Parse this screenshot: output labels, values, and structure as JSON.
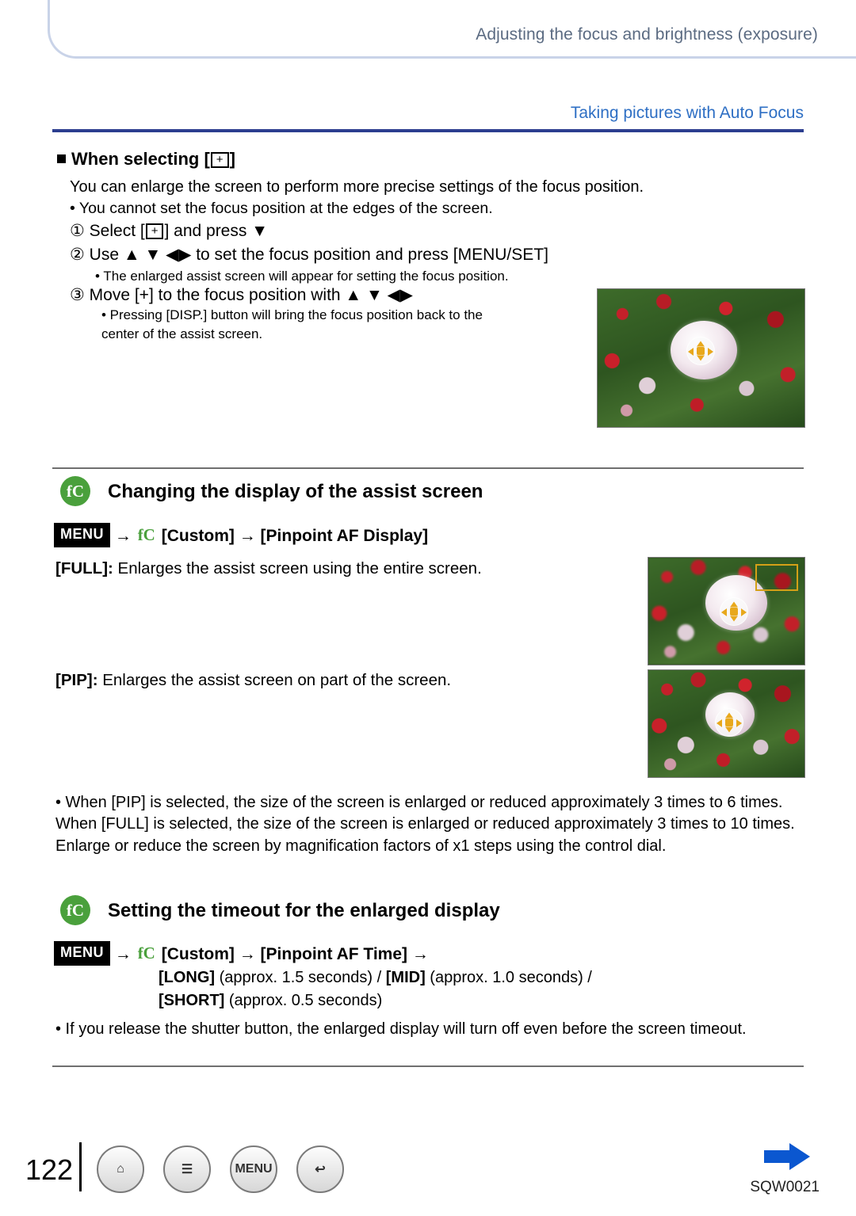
{
  "header": {
    "title": "Adjusting the focus and brightness (exposure)",
    "section": "Taking pictures with Auto Focus"
  },
  "when_selecting": {
    "heading": "When selecting [",
    "heading_icon": "+",
    "heading_end": "]",
    "line1": "You can enlarge the screen to perform more precise settings of the focus position.",
    "line2": "• You cannot set the focus position at the edges of the screen.",
    "step1_pre": "① Select [",
    "step1_icon": "+",
    "step1_post": "] and press ▼",
    "step2": "② Use ▲ ▼ ◀▶ to set the focus position and press [MENU/SET]",
    "step2_note": "• The enlarged assist screen will appear for setting the focus position.",
    "step3": "③ Move [+] to the focus position with ▲ ▼ ◀▶",
    "step3_note_line1": "• Pressing [DISP.] button will bring the focus position back to the",
    "step3_note_line2": "center of the assist screen."
  },
  "section_display": {
    "badge": "fC",
    "title": "Changing the display of the assist screen",
    "menu_chip": "MENU",
    "arrow": "→",
    "wrench": "fC",
    "path_custom": "[Custom]",
    "path_item": "[Pinpoint AF Display]",
    "full_label": "[FULL]:",
    "full_text": " Enlarges the assist screen using the entire screen.",
    "pip_label": "[PIP]:",
    "pip_text": " Enlarges the assist screen on part of the screen.",
    "note": "• When [PIP] is selected, the size of the screen is enlarged or reduced approximately 3 times to 6 times. When [FULL] is selected, the size of the screen is enlarged or reduced approximately 3 times to 10 times. Enlarge or reduce the screen by magnification factors of x1 steps using the control dial."
  },
  "section_timeout": {
    "badge": "fC",
    "title": "Setting the timeout for the enlarged display",
    "menu_chip": "MENU",
    "arrow": "→",
    "wrench": "fC",
    "path_custom": "[Custom]",
    "path_item": "[Pinpoint AF Time]",
    "path_arrow_end": "→",
    "values_line1_bold1": "[LONG]",
    "values_line1_mid1": " (approx. 1.5 seconds) / ",
    "values_line1_bold2": "[MID]",
    "values_line1_mid2": " (approx. 1.0 seconds) /",
    "values_line2_bold": "[SHORT]",
    "values_line2_text": " (approx. 0.5 seconds)",
    "note": "• If you release the shutter button, the enlarged display will turn off even before the screen timeout."
  },
  "footer": {
    "page": "122",
    "buttons": [
      {
        "name": "home-button",
        "glyph": "⌂"
      },
      {
        "name": "list-button",
        "glyph": "☰"
      },
      {
        "name": "menu-button",
        "glyph": "MENU"
      },
      {
        "name": "back-button",
        "glyph": "↩"
      }
    ],
    "doc_code": "SQW0021"
  },
  "colors": {
    "accent_blue": "#2e6fc4",
    "rule_blue": "#2c3e8f",
    "badge_green": "#4aa03c",
    "arrow_blue": "#0b57d0"
  }
}
